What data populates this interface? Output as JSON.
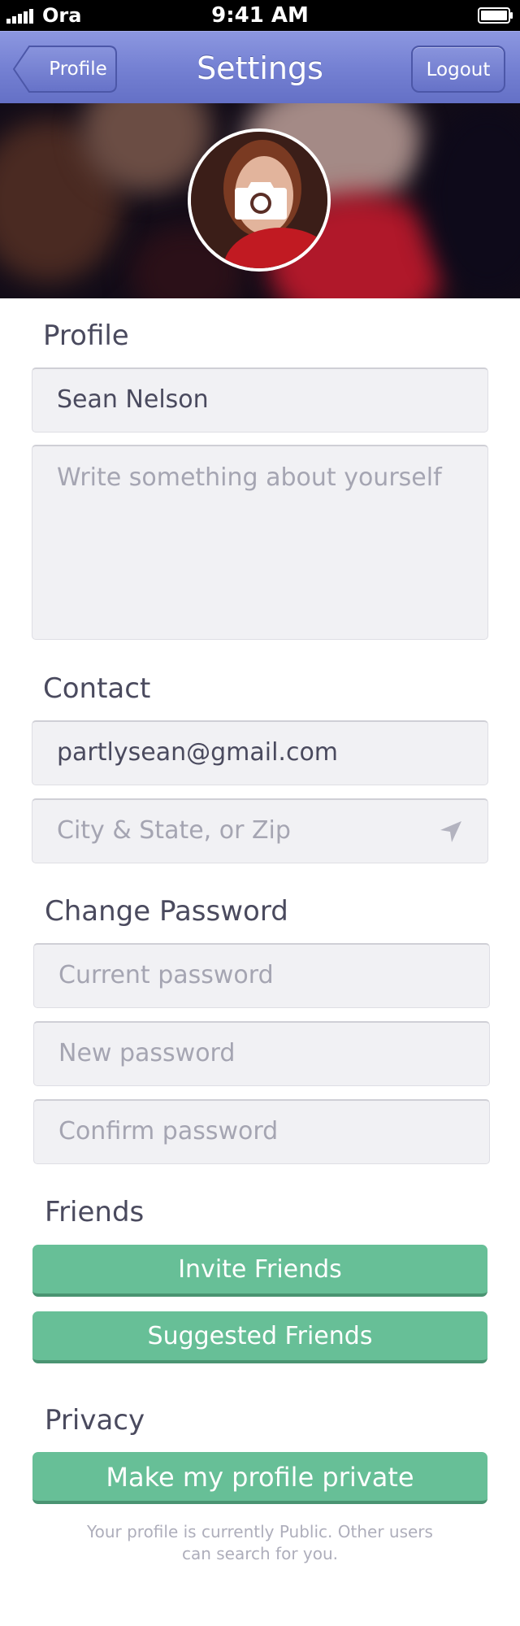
{
  "status_bar": {
    "carrier": "Ora",
    "time": "9:41 AM"
  },
  "nav": {
    "title": "Settings",
    "back_label": "Profile",
    "logout_label": "Logout",
    "bar_color": "#7581d3"
  },
  "header": {
    "avatar_icon": "camera-icon"
  },
  "profile": {
    "section_label": "Profile",
    "name_value": "Sean Nelson",
    "about_placeholder": "Write something about yourself"
  },
  "contact": {
    "section_label": "Contact",
    "email_value": "partlysean@gmail.com",
    "location_placeholder": "City & State, or Zip",
    "location_icon": "location-arrow-icon"
  },
  "password": {
    "section_label": "Change Password",
    "current_placeholder": "Current password",
    "new_placeholder": "New password",
    "confirm_placeholder": "Confirm password"
  },
  "friends": {
    "section_label": "Friends",
    "invite_label": "Invite Friends",
    "suggested_label": "Suggested Friends"
  },
  "privacy": {
    "section_label": "Privacy",
    "private_button_label": "Make my profile private",
    "note_line1": "Your profile is currently Public. Other users",
    "note_line2": "can search for you."
  },
  "colors": {
    "accent_green": "#67bf97",
    "nav_blue": "#7581d3",
    "field_bg": "#f1f1f4"
  }
}
